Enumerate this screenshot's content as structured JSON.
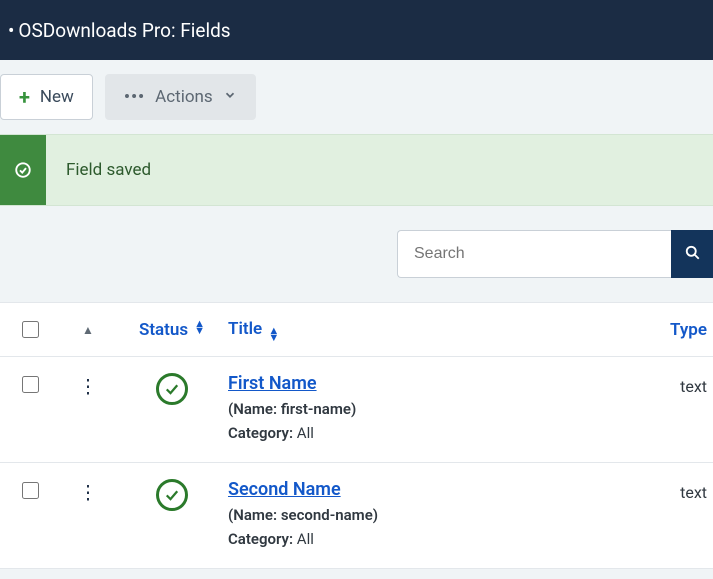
{
  "header": {
    "title": "OSDownloads Pro: Fields"
  },
  "toolbar": {
    "new_label": "New",
    "actions_label": "Actions"
  },
  "alert": {
    "message": "Field saved"
  },
  "search": {
    "placeholder": "Search"
  },
  "columns": {
    "status": "Status",
    "title": "Title",
    "type": "Type"
  },
  "meta_labels": {
    "name_prefix": "(Name: ",
    "name_suffix": ")",
    "category_prefix": "Category: "
  },
  "rows": [
    {
      "title": "First Name",
      "name": "first-name",
      "category": "All",
      "type": "text"
    },
    {
      "title": "Second Name",
      "name": "second-name",
      "category": "All",
      "type": "text"
    }
  ]
}
